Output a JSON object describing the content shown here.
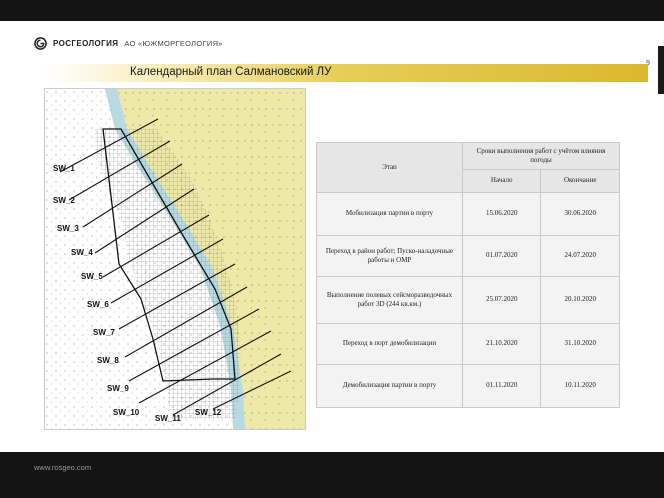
{
  "slide": {
    "logo_name": "РОСГЕОЛОГИЯ",
    "logo_sub": "АО «ЮЖМОРГЕОЛОГИЯ»",
    "title": "Календарный план Салмановский ЛУ",
    "page_number": "9",
    "footer_url": "www.rosgeo.com"
  },
  "colors": {
    "accent_gold": "#d9b92c",
    "land": "#efe9a7",
    "shore": "#b8dbe3",
    "sea": "#ffffff",
    "bars": "#141414"
  },
  "map": {
    "profiles": [
      "SW_1",
      "SW_2",
      "SW_3",
      "SW_4",
      "SW_5",
      "SW_6",
      "SW_7",
      "SW_8",
      "SW_9",
      "SW_10",
      "SW_11",
      "SW_12"
    ]
  },
  "table": {
    "header_stage": "Этап",
    "header_period": "Сроки выполнения работ с учётом влияния погоды",
    "header_start": "Начало",
    "header_end": "Окончание",
    "rows": [
      {
        "stage": "Мобилизация партии в порту",
        "start": "15.06.2020",
        "end": "30.06.2020"
      },
      {
        "stage": "Переход в район работ; Пуско-наладочные работы и ОМР",
        "start": "01.07.2020",
        "end": "24.07.2020"
      },
      {
        "stage": "Выполнение полевых сейсморазведочных работ 3D (244 кв.км.)",
        "start": "25.07.2020",
        "end": "20.10.2020"
      },
      {
        "stage": "Переход в порт демобилизации",
        "start": "21.10.2020",
        "end": "31.10.2020"
      },
      {
        "stage": "Демобилизация партии в порту",
        "start": "01.11.2020",
        "end": "10.11.2020"
      }
    ]
  }
}
